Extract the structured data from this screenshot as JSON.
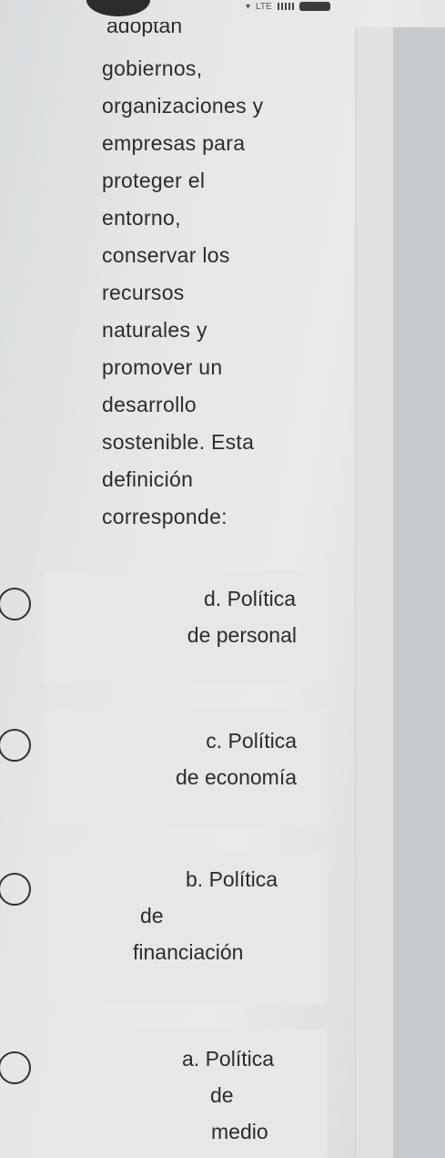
{
  "status_bar": {
    "network": "LTE"
  },
  "question": {
    "partial_top": "adoptan",
    "lines": [
      "gobiernos,",
      "organizaciones y",
      "empresas para",
      "proteger el",
      "entorno,",
      "conservar los",
      "recursos",
      "naturales y",
      "promover un",
      "desarrollo",
      "sostenible. Esta",
      "definición",
      "corresponde:"
    ]
  },
  "options": [
    {
      "lines": [
        "d. Política",
        "de personal"
      ]
    },
    {
      "lines": [
        "c. Política",
        "de economía"
      ]
    },
    {
      "lines": [
        "b. Política",
        "de",
        "financiación"
      ]
    },
    {
      "lines": [
        "a. Política",
        "de",
        "medio"
      ]
    }
  ]
}
